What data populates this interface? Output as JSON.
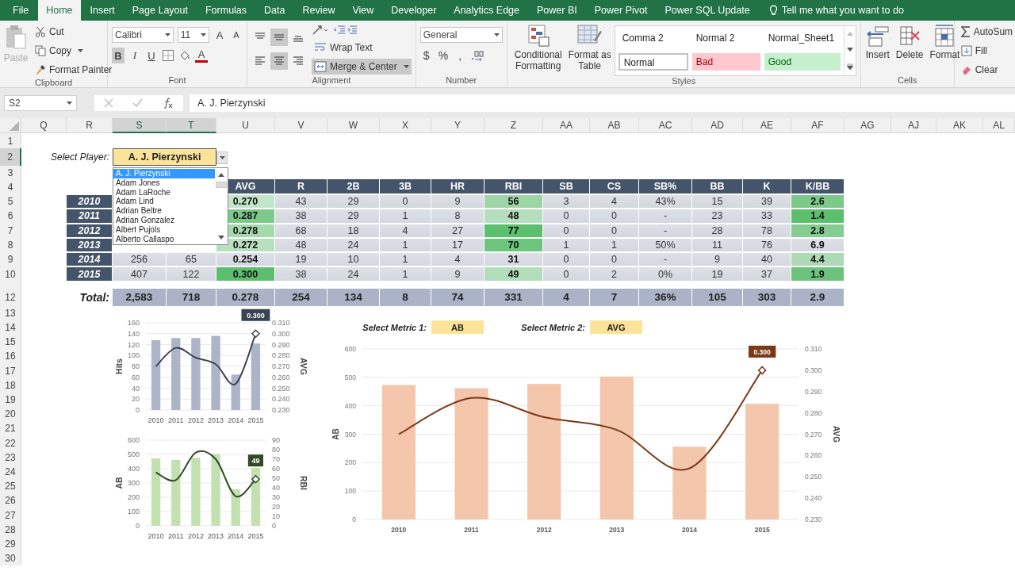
{
  "ribbon_tabs": [
    {
      "label": "File",
      "selected": false
    },
    {
      "label": "Home",
      "selected": true
    },
    {
      "label": "Insert",
      "selected": false
    },
    {
      "label": "Page Layout",
      "selected": false
    },
    {
      "label": "Formulas",
      "selected": false
    },
    {
      "label": "Data",
      "selected": false
    },
    {
      "label": "Review",
      "selected": false
    },
    {
      "label": "View",
      "selected": false
    },
    {
      "label": "Developer",
      "selected": false
    },
    {
      "label": "Analytics Edge",
      "selected": false
    },
    {
      "label": "Power BI",
      "selected": false
    },
    {
      "label": "Power Pivot",
      "selected": false
    },
    {
      "label": "Power SQL Update",
      "selected": false
    }
  ],
  "tell_me": "Tell me what you want to do",
  "clipboard": {
    "paste": "Paste",
    "cut": "Cut",
    "copy": "Copy",
    "format_painter": "Format Painter",
    "label": "Clipboard"
  },
  "font": {
    "name": "Calibri",
    "size": "11",
    "grow": "A",
    "shrink": "A",
    "color_button": "A",
    "label": "Font",
    "toggles": [
      {
        "kind": "bold",
        "label": "B",
        "on": true
      },
      {
        "kind": "italic",
        "label": "I",
        "on": false
      },
      {
        "kind": "underline",
        "label": "U",
        "on": false
      }
    ]
  },
  "alignment": {
    "label": "Alignment",
    "wrap": {
      "label": "Wrap Text",
      "on": false
    },
    "merge": {
      "label": "Merge & Center",
      "on": true
    },
    "buttons": [
      {
        "kind": "top",
        "on": false
      },
      {
        "kind": "middle",
        "on": true
      },
      {
        "kind": "bottom",
        "on": false
      },
      {
        "kind": "left",
        "on": false
      },
      {
        "kind": "center",
        "on": true
      },
      {
        "kind": "right",
        "on": false
      }
    ]
  },
  "number": {
    "format": "General",
    "symbols": [
      "$",
      "%",
      ","
    ],
    "label": "Number"
  },
  "styles": {
    "conditional": "Conditional Formatting",
    "format_table": "Format as Table",
    "label": "Styles",
    "gallery": [
      {
        "label": "Comma 2",
        "kind": "plain",
        "selected": false
      },
      {
        "label": "Normal 2",
        "kind": "plain",
        "selected": false
      },
      {
        "label": "Normal_Sheet1",
        "kind": "plain",
        "selected": false
      },
      {
        "label": "Normal",
        "kind": "normal",
        "selected": true
      },
      {
        "label": "Bad",
        "kind": "bad",
        "selected": false
      },
      {
        "label": "Good",
        "kind": "good",
        "selected": false
      }
    ]
  },
  "cells": {
    "insert": "Insert",
    "delete": "Delete",
    "format": "Format",
    "label": "Cells"
  },
  "editing": {
    "autosum": "AutoSum",
    "fill": "Fill",
    "clear": "Clear"
  },
  "formula_bar": {
    "name_box": "S2",
    "formula": "A. J. Pierzynski"
  },
  "column_headers": [
    {
      "label": "Q",
      "selected": false
    },
    {
      "label": "R",
      "selected": false
    },
    {
      "label": "S",
      "selected": true
    },
    {
      "label": "T",
      "selected": true
    },
    {
      "label": "U",
      "selected": false
    },
    {
      "label": "V",
      "selected": false
    },
    {
      "label": "W",
      "selected": false
    },
    {
      "label": "X",
      "selected": false
    },
    {
      "label": "Y",
      "selected": false
    },
    {
      "label": "Z",
      "selected": false
    },
    {
      "label": "AA",
      "selected": false
    },
    {
      "label": "AB",
      "selected": false
    },
    {
      "label": "AC",
      "selected": false
    },
    {
      "label": "AD",
      "selected": false
    },
    {
      "label": "AE",
      "selected": false
    },
    {
      "label": "AF",
      "selected": false
    },
    {
      "label": "AG",
      "selected": false
    },
    {
      "label": "AJ",
      "selected": false
    },
    {
      "label": "AK",
      "selected": false
    },
    {
      "label": "AL",
      "selected": false
    }
  ],
  "row_headers": [
    {
      "label": "1",
      "selected": false
    },
    {
      "label": "2",
      "selected": true
    },
    {
      "label": "3",
      "selected": false
    },
    {
      "label": "4",
      "selected": false
    },
    {
      "label": "5",
      "selected": false
    },
    {
      "label": "6",
      "selected": false
    },
    {
      "label": "7",
      "selected": false
    },
    {
      "label": "8",
      "selected": false
    },
    {
      "label": "9",
      "selected": false
    },
    {
      "label": "10",
      "selected": false
    },
    {
      "label": "12",
      "selected": false
    },
    {
      "label": "13",
      "selected": false
    },
    {
      "label": "14",
      "selected": false
    },
    {
      "label": "15",
      "selected": false
    },
    {
      "label": "16",
      "selected": false
    },
    {
      "label": "17",
      "selected": false
    },
    {
      "label": "18",
      "selected": false
    },
    {
      "label": "19",
      "selected": false
    },
    {
      "label": "20",
      "selected": false
    },
    {
      "label": "21",
      "selected": false
    },
    {
      "label": "22",
      "selected": false
    },
    {
      "label": "23",
      "selected": false
    },
    {
      "label": "24",
      "selected": false
    },
    {
      "label": "25",
      "selected": false
    },
    {
      "label": "26",
      "selected": false
    },
    {
      "label": "27",
      "selected": false
    },
    {
      "label": "28",
      "selected": false
    },
    {
      "label": "29",
      "selected": false
    },
    {
      "label": "30",
      "selected": false
    }
  ],
  "player_select": {
    "label": "Select Player:",
    "value": "A. J. Pierzynski",
    "options": [
      {
        "label": "A. J. Pierzynski",
        "selected": true
      },
      {
        "label": "Adam Jones",
        "selected": false
      },
      {
        "label": "Adam LaRoche",
        "selected": false
      },
      {
        "label": "Adam Lind",
        "selected": false
      },
      {
        "label": "Adrian Beltre",
        "selected": false
      },
      {
        "label": "Adrian Gonzalez",
        "selected": false
      },
      {
        "label": "Albert Pujols",
        "selected": false
      },
      {
        "label": "Alberto Callaspo",
        "selected": false
      }
    ]
  },
  "stats_table": {
    "columns": [
      {
        "bold": false
      },
      {
        "bold": false
      },
      {
        "label": "AVG",
        "bold": true
      },
      {
        "label": "R",
        "bold": false
      },
      {
        "label": "2B",
        "bold": false
      },
      {
        "label": "3B",
        "bold": false
      },
      {
        "label": "HR",
        "bold": false
      },
      {
        "label": "RBI",
        "bold": true
      },
      {
        "label": "SB",
        "bold": false
      },
      {
        "label": "CS",
        "bold": false
      },
      {
        "label": "SB%",
        "bold": false
      },
      {
        "label": "BB",
        "bold": false
      },
      {
        "label": "K",
        "bold": false
      },
      {
        "label": "K/BB",
        "bold": true
      }
    ],
    "rows": [
      {
        "year": "2010",
        "cells": [
          null,
          null,
          {
            "text": "0.270",
            "color": "#c3e5c9"
          },
          {
            "text": "43"
          },
          {
            "text": "29"
          },
          {
            "text": "0"
          },
          {
            "text": "9"
          },
          {
            "text": "56",
            "color": "#9dd5a6"
          },
          {
            "text": "3"
          },
          {
            "text": "4"
          },
          {
            "text": "43%"
          },
          {
            "text": "15"
          },
          {
            "text": "39"
          },
          {
            "text": "2.6",
            "color": "#7cc98a"
          }
        ]
      },
      {
        "year": "2011",
        "cells": [
          null,
          null,
          {
            "text": "0.287",
            "color": "#7cc98a"
          },
          {
            "text": "38"
          },
          {
            "text": "29"
          },
          {
            "text": "1"
          },
          {
            "text": "8"
          },
          {
            "text": "48",
            "color": "#b5dfbc"
          },
          {
            "text": "0"
          },
          {
            "text": "0"
          },
          {
            "text": "-"
          },
          {
            "text": "23"
          },
          {
            "text": "33"
          },
          {
            "text": "1.4",
            "color": "#5cbf6e"
          }
        ]
      },
      {
        "year": "2012",
        "cells": [
          null,
          null,
          {
            "text": "0.278",
            "color": "#a5d9ae"
          },
          {
            "text": "68"
          },
          {
            "text": "18"
          },
          {
            "text": "4"
          },
          {
            "text": "27"
          },
          {
            "text": "77",
            "color": "#5cbf6e"
          },
          {
            "text": "0"
          },
          {
            "text": "0"
          },
          {
            "text": "-"
          },
          {
            "text": "28"
          },
          {
            "text": "78"
          },
          {
            "text": "2.8",
            "color": "#85cc92"
          }
        ]
      },
      {
        "year": "2013",
        "cells": [
          null,
          null,
          {
            "text": "0.272",
            "color": "#b8e0bf"
          },
          {
            "text": "48"
          },
          {
            "text": "24"
          },
          {
            "text": "1"
          },
          {
            "text": "17"
          },
          {
            "text": "70",
            "color": "#6dc57d"
          },
          {
            "text": "1"
          },
          {
            "text": "1"
          },
          {
            "text": "50%"
          },
          {
            "text": "11"
          },
          {
            "text": "76"
          },
          {
            "text": "6.9"
          }
        ]
      },
      {
        "year": "2014",
        "cells": [
          {
            "text": "256"
          },
          {
            "text": "65"
          },
          {
            "text": "0.254"
          },
          {
            "text": "19"
          },
          {
            "text": "10"
          },
          {
            "text": "1"
          },
          {
            "text": "4"
          },
          {
            "text": "31"
          },
          {
            "text": "0"
          },
          {
            "text": "0"
          },
          {
            "text": "-"
          },
          {
            "text": "9"
          },
          {
            "text": "40"
          },
          {
            "text": "4.4",
            "color": "#add9b5"
          }
        ]
      },
      {
        "year": "2015",
        "cells": [
          {
            "text": "407"
          },
          {
            "text": "122"
          },
          {
            "text": "0.300",
            "color": "#5cbf6e"
          },
          {
            "text": "38"
          },
          {
            "text": "24"
          },
          {
            "text": "1"
          },
          {
            "text": "9"
          },
          {
            "text": "49",
            "color": "#b2debb"
          },
          {
            "text": "0"
          },
          {
            "text": "2"
          },
          {
            "text": "0%"
          },
          {
            "text": "19"
          },
          {
            "text": "37"
          },
          {
            "text": "1.9",
            "color": "#6cc47c"
          }
        ]
      }
    ],
    "total_label": "Total:",
    "totals": [
      "2,583",
      "718",
      "0.278",
      "254",
      "134",
      "8",
      "74",
      "331",
      "4",
      "7",
      "36%",
      "105",
      "303",
      "2.9"
    ]
  },
  "metric_select": [
    {
      "label": "Select Metric 1:",
      "value": "AB"
    },
    {
      "label": "Select Metric 2:",
      "value": "AVG"
    }
  ],
  "charts": [
    {
      "chart_data": {
        "type": "bar",
        "categories": [
          "2010",
          "2011",
          "2012",
          "2013",
          "2014",
          "2015"
        ],
        "grid": true,
        "ylabel": "Hits",
        "y2label": "AVG",
        "ylim": [
          0,
          160
        ],
        "yticks": [
          0,
          20,
          40,
          60,
          80,
          100,
          120,
          140,
          160
        ],
        "y2lim": [
          0.23,
          0.31
        ],
        "y2ticks": [
          {
            "value": 0.23,
            "label": "0.230"
          },
          {
            "value": 0.24,
            "label": "0.240"
          },
          {
            "value": 0.25,
            "label": "0.250"
          },
          {
            "value": 0.26,
            "label": "0.260"
          },
          {
            "value": 0.27,
            "label": "0.270"
          },
          {
            "value": 0.28,
            "label": "0.280"
          },
          {
            "value": 0.29,
            "label": "0.290"
          },
          {
            "value": 0.3,
            "label": "0.300"
          },
          {
            "value": 0.31,
            "label": "0.310"
          }
        ],
        "series": [
          {
            "type": "bar",
            "color": "#adb4c8",
            "values": [
              128,
              132,
              132,
              136,
              65,
              122
            ]
          },
          {
            "type": "line",
            "axis": "y2",
            "color": "#3a4454",
            "values": [
              0.27,
              0.287,
              0.278,
              0.272,
              0.254,
              0.3
            ]
          }
        ],
        "annotations": [
          "0.300"
        ]
      }
    },
    {
      "chart_data": {
        "type": "bar",
        "categories": [
          "2010",
          "2011",
          "2012",
          "2013",
          "2014",
          "2015"
        ],
        "grid": true,
        "ylabel": "AB",
        "y2label": "RBI",
        "ylim": [
          0,
          600
        ],
        "yticks": [
          0,
          100,
          200,
          300,
          400,
          500,
          600
        ],
        "y2lim": [
          0,
          90
        ],
        "y2ticks": [
          {
            "value": 0,
            "label": "0"
          },
          {
            "value": 10,
            "label": "10"
          },
          {
            "value": 20,
            "label": "20"
          },
          {
            "value": 30,
            "label": "30"
          },
          {
            "value": 40,
            "label": "40"
          },
          {
            "value": 50,
            "label": "50"
          },
          {
            "value": 60,
            "label": "60"
          },
          {
            "value": 70,
            "label": "70"
          },
          {
            "value": 80,
            "label": "80"
          },
          {
            "value": 90,
            "label": "90"
          }
        ],
        "series": [
          {
            "type": "bar",
            "color": "#c3e0b1",
            "values": [
              473,
              462,
              477,
              503,
              256,
              407
            ]
          },
          {
            "type": "line",
            "axis": "y2",
            "color": "#2f4a24",
            "values": [
              56,
              48,
              77,
              70,
              31,
              49
            ]
          }
        ],
        "annotations": [
          "49"
        ]
      }
    },
    {
      "chart_data": {
        "type": "bar",
        "categories": [
          "2010",
          "2011",
          "2012",
          "2013",
          "2014",
          "2015"
        ],
        "grid": true,
        "ylabel": "AB",
        "y2label": "AVG",
        "ylim": [
          0,
          600
        ],
        "yticks": [
          0,
          100,
          200,
          300,
          400,
          500,
          600
        ],
        "y2lim": [
          0.23,
          0.31
        ],
        "y2ticks": [
          {
            "value": 0.23,
            "label": "0.230"
          },
          {
            "value": 0.24,
            "label": "0.240"
          },
          {
            "value": 0.25,
            "label": "0.250"
          },
          {
            "value": 0.26,
            "label": "0.260"
          },
          {
            "value": 0.27,
            "label": "0.270"
          },
          {
            "value": 0.28,
            "label": "0.280"
          },
          {
            "value": 0.29,
            "label": "0.290"
          },
          {
            "value": 0.3,
            "label": "0.300"
          },
          {
            "value": 0.31,
            "label": "0.310"
          }
        ],
        "series": [
          {
            "type": "bar",
            "color": "#f4c6ab",
            "values": [
              473,
              462,
              477,
              503,
              256,
              407
            ]
          },
          {
            "type": "line",
            "axis": "y2",
            "color": "#7b3a17",
            "values": [
              0.27,
              0.287,
              0.278,
              0.272,
              0.254,
              0.3
            ]
          }
        ],
        "annotations": [
          "0.300"
        ]
      }
    }
  ]
}
